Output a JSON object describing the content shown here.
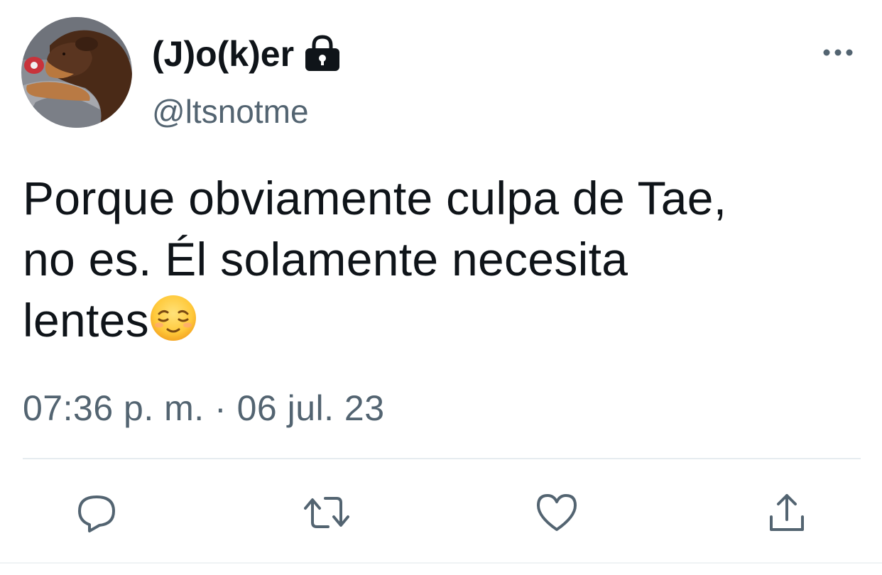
{
  "author": {
    "display_name": "(J)o(k)er",
    "handle": "@ltsnotme",
    "protected_icon": "lock-icon",
    "avatar": "dog-avatar"
  },
  "tweet": {
    "text_parts": [
      "Porque obviamente culpa de Tae,",
      "no es. Él solamente necesita",
      "lentes"
    ],
    "emoji": "relieved-face-emoji",
    "timestamp": "07:36 p. m. · 06 jul. 23"
  },
  "actions": [
    {
      "icon": "reply-icon"
    },
    {
      "icon": "retweet-icon"
    },
    {
      "icon": "like-icon"
    },
    {
      "icon": "share-icon"
    }
  ],
  "menu": {
    "icon": "more-options-icon"
  },
  "colors": {
    "text": "#0f1419",
    "secondary": "#536471",
    "divider": "#e6ecf0"
  }
}
